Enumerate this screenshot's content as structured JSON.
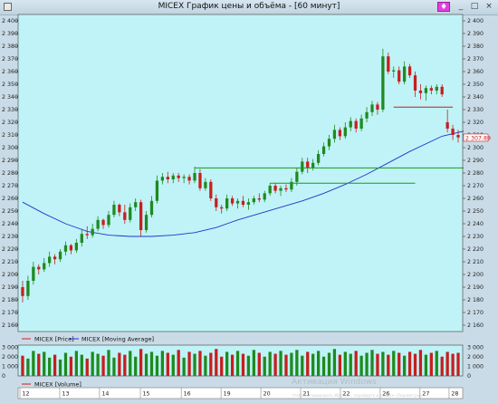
{
  "window": {
    "title": "MICEX График цены и объёма - [60 минут]",
    "pin_label": "♦",
    "minimize_label": "_",
    "maximize_label": "□",
    "close_label": "×"
  },
  "legend": {
    "price": "MICEX [Price]",
    "ma": "MICEX [Moving Average]",
    "volume": "MICEX [Volume]"
  },
  "watermark": {
    "line1": "Активация Windows",
    "line2": "Чтобы активировать Windows, перейдите в раздел «Параметры»."
  },
  "colors": {
    "plot_bg": "#bff3f7",
    "up": "#1f8a1f",
    "down": "#c81e1e",
    "ma": "#2233cc",
    "support": "#1a9a1a",
    "resistance": "#d01818",
    "price_tag_bg": "#ffffff",
    "price_tag_fg": "#c81e1e"
  },
  "chart_data": {
    "type": "candlestick",
    "title": "MICEX График цены и объёма - [60 минут]",
    "y_ticks": [
      "2 400",
      "2 390",
      "2 380",
      "2 370",
      "2 360",
      "2 350",
      "2 340",
      "2 330",
      "2 320",
      "2 310",
      "2 300",
      "2 290",
      "2 280",
      "2 270",
      "2 260",
      "2 250",
      "2 240",
      "2 230",
      "2 220",
      "2 210",
      "2 200",
      "2 190",
      "2 180",
      "2 170",
      "2 160"
    ],
    "ylim": [
      2155,
      2405
    ],
    "x_ticks": [
      "12",
      "13",
      "14",
      "15",
      "16",
      "19",
      "20",
      "21",
      "22",
      "26",
      "27",
      "28"
    ],
    "volume_ticks": [
      "3 000",
      "2 000",
      "1 000",
      "0"
    ],
    "volume_ylim": [
      0,
      3200
    ],
    "last_price_label": "2 307.89",
    "last_price": 2307.89,
    "candles": [
      [
        2190,
        2195,
        2178,
        2183
      ],
      [
        2183,
        2199,
        2180,
        2195
      ],
      [
        2195,
        2210,
        2192,
        2206
      ],
      [
        2206,
        2208,
        2200,
        2204
      ],
      [
        2204,
        2213,
        2202,
        2209
      ],
      [
        2209,
        2218,
        2206,
        2214
      ],
      [
        2214,
        2216,
        2208,
        2212
      ],
      [
        2212,
        2220,
        2210,
        2218
      ],
      [
        2218,
        2226,
        2215,
        2223
      ],
      [
        2223,
        2224,
        2216,
        2219
      ],
      [
        2219,
        2228,
        2217,
        2225
      ],
      [
        2225,
        2236,
        2222,
        2232
      ],
      [
        2232,
        2238,
        2228,
        2231
      ],
      [
        2231,
        2240,
        2229,
        2236
      ],
      [
        2236,
        2246,
        2234,
        2243
      ],
      [
        2243,
        2244,
        2236,
        2239
      ],
      [
        2239,
        2250,
        2237,
        2247
      ],
      [
        2247,
        2258,
        2245,
        2255
      ],
      [
        2255,
        2256,
        2246,
        2249
      ],
      [
        2249,
        2255,
        2240,
        2243
      ],
      [
        2243,
        2256,
        2241,
        2253
      ],
      [
        2253,
        2260,
        2250,
        2257
      ],
      [
        2257,
        2259,
        2230,
        2235
      ],
      [
        2235,
        2250,
        2233,
        2247
      ],
      [
        2247,
        2262,
        2245,
        2258
      ],
      [
        2258,
        2278,
        2256,
        2274
      ],
      [
        2274,
        2280,
        2271,
        2277
      ],
      [
        2277,
        2281,
        2272,
        2275
      ],
      [
        2275,
        2280,
        2272,
        2278
      ],
      [
        2278,
        2280,
        2273,
        2276
      ],
      [
        2276,
        2279,
        2272,
        2277
      ],
      [
        2277,
        2279,
        2271,
        2274
      ],
      [
        2274,
        2285,
        2272,
        2280
      ],
      [
        2280,
        2283,
        2266,
        2268
      ],
      [
        2268,
        2276,
        2266,
        2273
      ],
      [
        2273,
        2275,
        2258,
        2260
      ],
      [
        2260,
        2263,
        2250,
        2253
      ],
      [
        2253,
        2255,
        2248,
        2252
      ],
      [
        2252,
        2263,
        2250,
        2260
      ],
      [
        2260,
        2262,
        2254,
        2256
      ],
      [
        2256,
        2260,
        2252,
        2258
      ],
      [
        2258,
        2262,
        2253,
        2255
      ],
      [
        2255,
        2260,
        2251,
        2257
      ],
      [
        2257,
        2262,
        2255,
        2260
      ],
      [
        2260,
        2264,
        2257,
        2259
      ],
      [
        2259,
        2266,
        2257,
        2264
      ],
      [
        2264,
        2272,
        2262,
        2270
      ],
      [
        2270,
        2272,
        2264,
        2266
      ],
      [
        2266,
        2270,
        2262,
        2268
      ],
      [
        2268,
        2271,
        2265,
        2267
      ],
      [
        2267,
        2276,
        2265,
        2273
      ],
      [
        2273,
        2284,
        2270,
        2281
      ],
      [
        2281,
        2292,
        2279,
        2289
      ],
      [
        2289,
        2292,
        2280,
        2284
      ],
      [
        2284,
        2291,
        2282,
        2288
      ],
      [
        2288,
        2298,
        2286,
        2295
      ],
      [
        2295,
        2304,
        2293,
        2301
      ],
      [
        2301,
        2310,
        2298,
        2307
      ],
      [
        2307,
        2318,
        2304,
        2314
      ],
      [
        2314,
        2316,
        2306,
        2309
      ],
      [
        2309,
        2320,
        2307,
        2316
      ],
      [
        2316,
        2324,
        2313,
        2321
      ],
      [
        2321,
        2323,
        2312,
        2315
      ],
      [
        2315,
        2326,
        2313,
        2323
      ],
      [
        2323,
        2332,
        2320,
        2328
      ],
      [
        2328,
        2337,
        2325,
        2334
      ],
      [
        2334,
        2336,
        2326,
        2330
      ],
      [
        2330,
        2378,
        2328,
        2372
      ],
      [
        2372,
        2375,
        2358,
        2360
      ],
      [
        2360,
        2364,
        2355,
        2361
      ],
      [
        2361,
        2364,
        2350,
        2352
      ],
      [
        2352,
        2368,
        2350,
        2364
      ],
      [
        2364,
        2366,
        2355,
        2357
      ],
      [
        2357,
        2360,
        2340,
        2345
      ],
      [
        2345,
        2350,
        2338,
        2343
      ],
      [
        2343,
        2349,
        2337,
        2347
      ],
      [
        2347,
        2349,
        2342,
        2345
      ],
      [
        2345,
        2350,
        2342,
        2348
      ],
      [
        2348,
        2350,
        2340,
        2342
      ],
      [
        2320,
        2330,
        2312,
        2315
      ],
      [
        2315,
        2318,
        2306,
        2310
      ],
      [
        2310,
        2314,
        2304,
        2308
      ]
    ],
    "moving_average": [
      [
        0,
        2257
      ],
      [
        4,
        2248
      ],
      [
        8,
        2240
      ],
      [
        12,
        2234
      ],
      [
        16,
        2231
      ],
      [
        20,
        2230
      ],
      [
        24,
        2230
      ],
      [
        28,
        2231
      ],
      [
        32,
        2233
      ],
      [
        36,
        2237
      ],
      [
        40,
        2243
      ],
      [
        44,
        2248
      ],
      [
        48,
        2253
      ],
      [
        52,
        2258
      ],
      [
        56,
        2264
      ],
      [
        60,
        2271
      ],
      [
        64,
        2279
      ],
      [
        68,
        2288
      ],
      [
        72,
        2297
      ],
      [
        76,
        2305
      ],
      [
        78,
        2309
      ],
      [
        82,
        2313
      ]
    ],
    "support_lines": [
      {
        "x1": 32,
        "x2": 82,
        "y": 2284
      },
      {
        "x1": 46,
        "x2": 73,
        "y": 2272
      }
    ],
    "resistance_lines": [
      {
        "x1": 69,
        "x2": 80,
        "y": 2332
      }
    ],
    "volumes": [
      2100,
      1800,
      2600,
      2300,
      2500,
      1900,
      2200,
      1700,
      2400,
      2000,
      2600,
      2200,
      1800,
      2500,
      2300,
      2100,
      2700,
      1900,
      2400,
      2200,
      2600,
      2000,
      2800,
      2300,
      2500,
      2100,
      2600,
      2400,
      2200,
      2700,
      1900,
      2500,
      2300,
      2600,
      2100,
      2400,
      2800,
      2000,
      2500,
      2200,
      2600,
      2300,
      2100,
      2700,
      2400,
      2000,
      2500,
      2300,
      2600,
      2200,
      2400,
      2700,
      2100,
      2500,
      2300,
      2600,
      2000,
      2400,
      2800,
      2200,
      2500,
      2300,
      2600,
      2100,
      2400,
      2700,
      2300,
      2500,
      2200,
      2600,
      2400,
      2100,
      2500,
      2300,
      2700,
      2200,
      2400,
      2600,
      2000,
      2500,
      2300,
      2400,
      2100
    ]
  }
}
